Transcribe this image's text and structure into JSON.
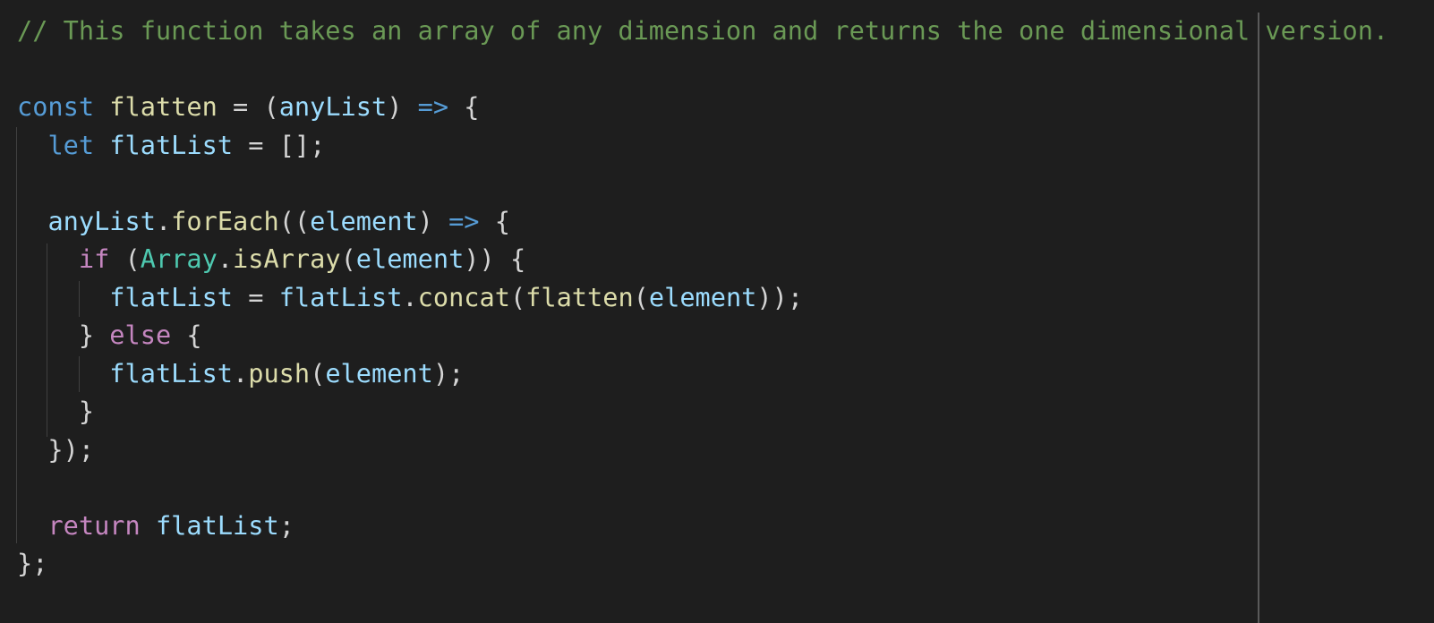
{
  "colors": {
    "background": "#1e1e1e",
    "comment": "#6a9955",
    "storage": "#569cd6",
    "function": "#dcdcaa",
    "variable": "#9cdcfe",
    "punctuation": "#d4d4d4",
    "keyword": "#c586c0",
    "class": "#4ec9b0",
    "indent_guide": "#404040",
    "ruler": "#5a5a5a"
  },
  "code": {
    "lines": [
      [
        [
          "c-comment",
          "// This function takes an array of any dimension and returns the one dimensional version."
        ]
      ],
      [],
      [
        [
          "c-storage",
          "const"
        ],
        [
          "c-punct",
          " "
        ],
        [
          "c-func",
          "flatten"
        ],
        [
          "c-punct",
          " = ("
        ],
        [
          "c-var",
          "anyList"
        ],
        [
          "c-punct",
          ") "
        ],
        [
          "c-storage",
          "=>"
        ],
        [
          "c-punct",
          " {"
        ]
      ],
      [
        [
          "c-punct",
          "  "
        ],
        [
          "c-storage",
          "let"
        ],
        [
          "c-punct",
          " "
        ],
        [
          "c-var",
          "flatList"
        ],
        [
          "c-punct",
          " = [];"
        ]
      ],
      [],
      [
        [
          "c-punct",
          "  "
        ],
        [
          "c-var",
          "anyList"
        ],
        [
          "c-punct",
          "."
        ],
        [
          "c-func",
          "forEach"
        ],
        [
          "c-punct",
          "(("
        ],
        [
          "c-var",
          "element"
        ],
        [
          "c-punct",
          ") "
        ],
        [
          "c-storage",
          "=>"
        ],
        [
          "c-punct",
          " {"
        ]
      ],
      [
        [
          "c-punct",
          "    "
        ],
        [
          "c-keyword",
          "if"
        ],
        [
          "c-punct",
          " ("
        ],
        [
          "c-class",
          "Array"
        ],
        [
          "c-punct",
          "."
        ],
        [
          "c-func",
          "isArray"
        ],
        [
          "c-punct",
          "("
        ],
        [
          "c-var",
          "element"
        ],
        [
          "c-punct",
          ")) {"
        ]
      ],
      [
        [
          "c-punct",
          "      "
        ],
        [
          "c-var",
          "flatList"
        ],
        [
          "c-punct",
          " = "
        ],
        [
          "c-var",
          "flatList"
        ],
        [
          "c-punct",
          "."
        ],
        [
          "c-func",
          "concat"
        ],
        [
          "c-punct",
          "("
        ],
        [
          "c-func",
          "flatten"
        ],
        [
          "c-punct",
          "("
        ],
        [
          "c-var",
          "element"
        ],
        [
          "c-punct",
          "));"
        ]
      ],
      [
        [
          "c-punct",
          "    } "
        ],
        [
          "c-keyword",
          "else"
        ],
        [
          "c-punct",
          " {"
        ]
      ],
      [
        [
          "c-punct",
          "      "
        ],
        [
          "c-var",
          "flatList"
        ],
        [
          "c-punct",
          "."
        ],
        [
          "c-func",
          "push"
        ],
        [
          "c-punct",
          "("
        ],
        [
          "c-var",
          "element"
        ],
        [
          "c-punct",
          ");"
        ]
      ],
      [
        [
          "c-punct",
          "    }"
        ]
      ],
      [
        [
          "c-punct",
          "  });"
        ]
      ],
      [],
      [
        [
          "c-punct",
          "  "
        ],
        [
          "c-keyword",
          "return"
        ],
        [
          "c-punct",
          " "
        ],
        [
          "c-var",
          "flatList"
        ],
        [
          "c-punct",
          ";"
        ]
      ],
      [
        [
          "c-punct",
          "};"
        ]
      ]
    ]
  }
}
